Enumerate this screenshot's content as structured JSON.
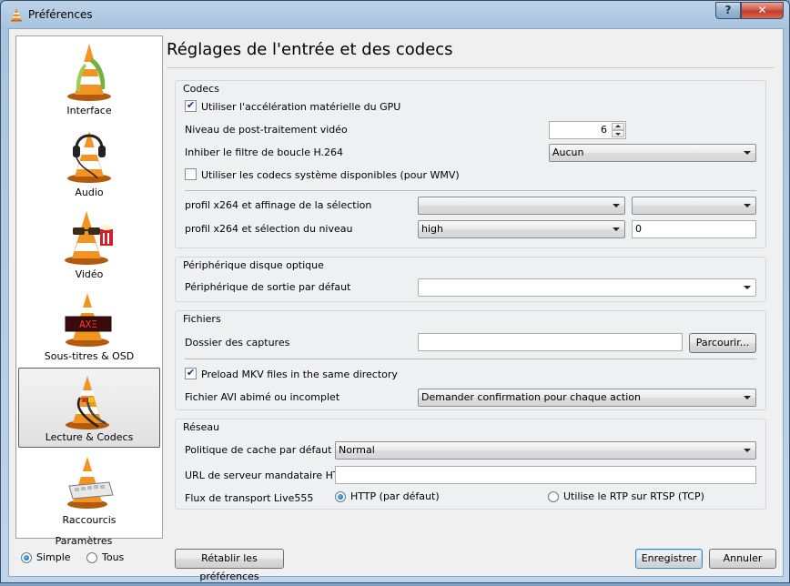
{
  "window": {
    "title": "Préférences",
    "help_label": "?",
    "close_label": "✕"
  },
  "sidebar": {
    "categories": [
      {
        "label": "Interface",
        "icon": "vlc-cone-interface-icon"
      },
      {
        "label": "Audio",
        "icon": "vlc-cone-headphones-icon"
      },
      {
        "label": "Vidéo",
        "icon": "vlc-cone-glasses-icon"
      },
      {
        "label": "Sous-titres & OSD",
        "icon": "vlc-cone-subtitles-icon"
      },
      {
        "label": "Lecture & Codecs",
        "icon": "vlc-cone-cables-icon",
        "selected": true
      },
      {
        "label": "Raccourcis",
        "icon": "vlc-cone-keyboard-icon"
      }
    ],
    "params": {
      "title": "Paramètres",
      "simple": "Simple",
      "all": "Tous",
      "selected": "Simple"
    }
  },
  "page": {
    "title": "Réglages de l'entrée et des codecs"
  },
  "codecs": {
    "title": "Codecs",
    "gpu_label": "Utiliser l'accélération matérielle du GPU",
    "gpu_checked": true,
    "postproc_label": "Niveau de post-traitement vidéo",
    "postproc_value": "6",
    "loop_label": "Inhiber le filtre de boucle H.264",
    "loop_value": "Aucun",
    "system_codecs_label": "Utiliser les codecs système disponibles (pour WMV)",
    "system_codecs_checked": false,
    "x264_tune_label": "profil x264 et affinage de la sélection",
    "x264_tune_value1": "",
    "x264_tune_value2": "",
    "x264_level_label": "profil x264 et sélection du niveau",
    "x264_level_value": "high",
    "x264_level_text": "0"
  },
  "optical": {
    "title": "Périphérique disque optique",
    "device_label": "Périphérique de sortie par défaut",
    "device_value": ""
  },
  "files": {
    "title": "Fichiers",
    "captures_label": "Dossier des captures",
    "captures_value": "",
    "browse_label": "Parcourir...",
    "mkv_label": "Preload MKV files in the same directory",
    "mkv_checked": true,
    "avi_label": "Fichier AVI abimé ou incomplet",
    "avi_value": "Demander confirmation pour chaque action"
  },
  "network": {
    "title": "Réseau",
    "cache_label": "Politique de cache par défaut",
    "cache_value": "Normal",
    "proxy_label": "URL de serveur mandataire HTTP",
    "proxy_value": "",
    "live555_label": "Flux de transport Live555",
    "http_label": "HTTP (par défaut)",
    "rtp_label": "Utilise le RTP sur RTSP (TCP)",
    "selected": "HTTP (par défaut)"
  },
  "footer": {
    "reset_label": "Rétablir les préférences",
    "save_label": "Enregistrer",
    "cancel_label": "Annuler"
  },
  "colors": {
    "vlc_orange": "#f08a1c",
    "selection_border": "#5a5a5a",
    "accent_blue": "#3c7fb1"
  }
}
